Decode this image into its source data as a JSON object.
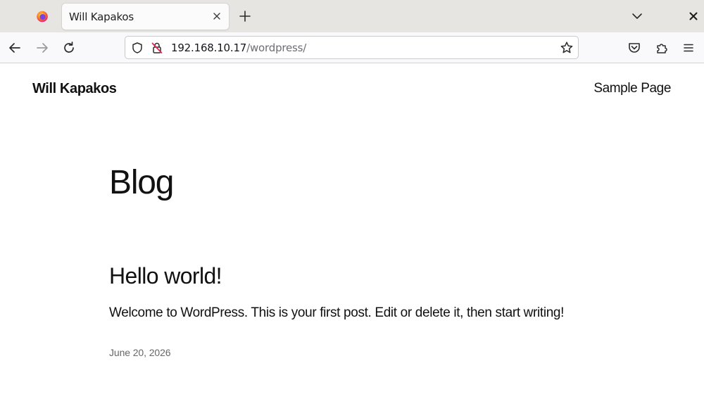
{
  "browser": {
    "tab": {
      "title": "Will Kapakos"
    },
    "url": {
      "host": "192.168.10.17",
      "path": "/wordpress/"
    }
  },
  "site": {
    "title": "Will Kapakos",
    "nav": [
      "Sample Page"
    ]
  },
  "main": {
    "heading": "Blog",
    "posts": [
      {
        "title": "Hello world!",
        "excerpt": "Welcome to WordPress. This is your first post. Edit or delete it, then start writing!",
        "date": "June 20, 2026"
      }
    ]
  },
  "icons": {
    "app": "firefox-icon",
    "tab_close": "close-icon",
    "new_tab": "plus-icon",
    "tab_list": "chevron-down-icon",
    "window_close": "close-icon",
    "back": "arrow-left-icon",
    "forward": "arrow-right-icon",
    "reload": "reload-icon",
    "tracking": "shield-icon",
    "security": "insecure-lock-icon",
    "bookmark": "star-icon",
    "pocket": "pocket-icon",
    "extensions": "puzzle-icon",
    "menu": "hamburger-menu-icon"
  },
  "colors": {
    "tabstrip": "#e7e5e2",
    "navbar": "#f9f9fb",
    "insecure": "#e22850",
    "text": "#111111",
    "muted": "#666666"
  }
}
